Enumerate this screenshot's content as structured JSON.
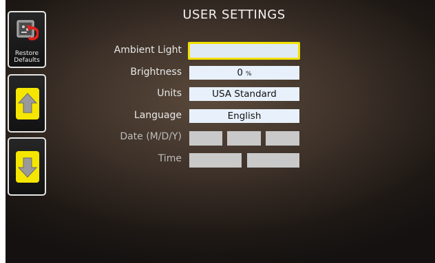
{
  "header": {
    "title": "USER SETTINGS"
  },
  "sidebar": {
    "restore_label": "Restore Defaults",
    "restore_icon": "restore-defaults-icon",
    "up_icon": "arrow-up-icon",
    "down_icon": "arrow-down-icon",
    "accent_color": "#f5e600"
  },
  "settings": {
    "ambient_light": {
      "label": "Ambient Light",
      "value": ""
    },
    "brightness": {
      "label": "Brightness",
      "value": "0",
      "unit": "%"
    },
    "units": {
      "label": "Units",
      "value": "USA Standard"
    },
    "language": {
      "label": "Language",
      "value": "English"
    },
    "date": {
      "label": "Date (M/D/Y)",
      "month": "",
      "day": "",
      "year": ""
    },
    "time": {
      "label": "Time",
      "hour": "",
      "minute": ""
    }
  },
  "colors": {
    "highlight_border": "#f2e000",
    "field_bg": "#e8f1fb",
    "disabled_field_bg": "#c9c9c9"
  }
}
